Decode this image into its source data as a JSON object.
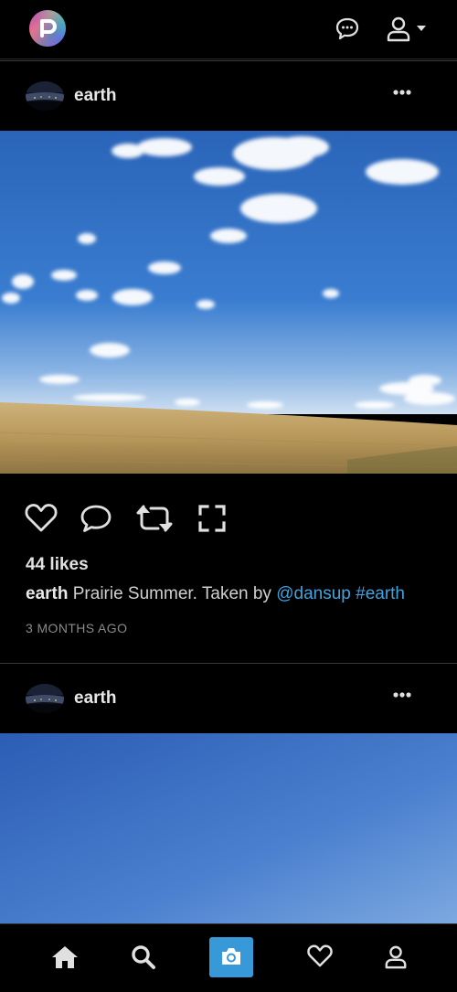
{
  "topbar": {
    "logo": "pixelfed-logo",
    "messages_icon": "chat-bubble-icon",
    "profile_icon": "user-icon",
    "dropdown_icon": "caret-down-icon"
  },
  "posts": [
    {
      "username": "earth",
      "more_icon": "ellipsis-icon",
      "photo": "prairie-sky-photo",
      "likes": "44 likes",
      "caption_user": "earth",
      "caption_text": "Prairie Summer. Taken by",
      "mention": "@dansup",
      "hashtag": "#earth",
      "timestamp": "3 MONTHS AGO"
    },
    {
      "username": "earth",
      "more_icon": "ellipsis-icon",
      "photo": "blue-sky-photo"
    }
  ],
  "bottom_nav": {
    "items": [
      "home-icon",
      "search-icon",
      "camera-icon",
      "heart-icon",
      "user-icon"
    ]
  },
  "colors": {
    "accent": "#3899d9",
    "link": "#3fa3e0",
    "background": "#000000"
  }
}
